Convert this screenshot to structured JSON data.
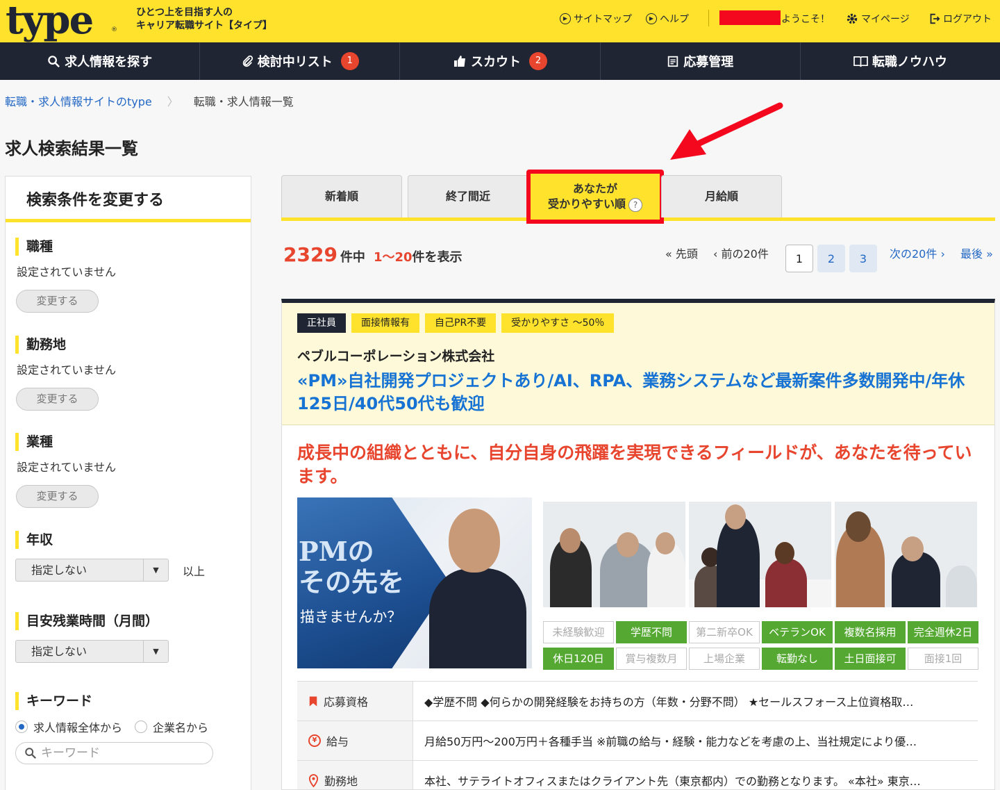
{
  "header": {
    "logo": "type",
    "logo_mark": "®",
    "tagline_1": "ひとつ上を目指す人の",
    "tagline_2": "キャリア転職サイト【タイプ】",
    "sitemap": "サイトマップ",
    "help": "ヘルプ",
    "welcome": "ようこそ！",
    "mypage": "マイページ",
    "logout": "ログアウト"
  },
  "nav": {
    "search": "求人情報を探す",
    "list": "検討中リスト",
    "list_badge": "1",
    "scout": "スカウト",
    "scout_badge": "2",
    "apply": "応募管理",
    "knowhow": "転職ノウハウ"
  },
  "breadcrumb": {
    "home": "転職・求人情報サイトのtype",
    "current": "転職・求人情報一覧"
  },
  "page_title": "求人検索結果一覧",
  "sidebar": {
    "title": "検索条件を変更する",
    "job_label": "職種",
    "job_value": "設定されていません",
    "location_label": "勤務地",
    "location_value": "設定されていません",
    "industry_label": "業種",
    "industry_value": "設定されていません",
    "change_button": "変更する",
    "salary_label": "年収",
    "salary_select": "指定しない",
    "salary_suffix": "以上",
    "overtime_label": "目安残業時間（月間）",
    "overtime_select": "指定しない",
    "keyword_label": "キーワード",
    "radio_all": "求人情報全体から",
    "radio_company": "企業名から",
    "keyword_placeholder": "キーワード"
  },
  "tabs": {
    "newest": "新着順",
    "ending": "終了間近",
    "easy_1": "あなたが",
    "easy_2": "受かりやすい順",
    "easy_help": "?",
    "salary": "月給順"
  },
  "results": {
    "total": "2329",
    "total_suffix": "件中",
    "range": "1〜20",
    "range_suffix": "件を表示"
  },
  "pager": {
    "first": "« 先頭",
    "prev": "‹ 前の20件",
    "p1": "1",
    "p2": "2",
    "p3": "3",
    "next": "次の20件 ›",
    "last": "最後 »"
  },
  "job": {
    "tag_type": "正社員",
    "tag_interview": "面接情報有",
    "tag_pr": "自己PR不要",
    "tag_ease": "受かりやすさ 〜50％",
    "company": "ペブルコーポレーション株式会社",
    "title": "«PM»自社開発プロジェクトあり/AI、RPA、業務システムなど最新案件多数開発中/年休125日/40代50代も歓迎",
    "catch": "成長中の組織とともに、自分自身の飛躍を実現できるフィールドが、あなたを待っています。",
    "image_text_1": "PMの",
    "image_text_2": "その先を",
    "image_text_3": "描きませんか？",
    "features": [
      {
        "label": "未経験歓迎",
        "on": false
      },
      {
        "label": "学歴不問",
        "on": true
      },
      {
        "label": "第二新卒OK",
        "on": false
      },
      {
        "label": "ベテランOK",
        "on": true
      },
      {
        "label": "複数名採用",
        "on": true
      },
      {
        "label": "完全週休2日",
        "on": true
      },
      {
        "label": "休日120日",
        "on": true
      },
      {
        "label": "賞与複数月",
        "on": false
      },
      {
        "label": "上場企業",
        "on": false
      },
      {
        "label": "転勤なし",
        "on": true
      },
      {
        "label": "土日面接可",
        "on": true
      },
      {
        "label": "面接1回",
        "on": false
      }
    ],
    "req_label": "応募資格",
    "req_value": "◆学歴不問 ◆何らかの開発経験をお持ちの方（年数・分野不問） ★セールスフォース上位資格取…",
    "salary_label": "給与",
    "salary_value": "月給50万円〜200万円＋各種手当 ※前職の給与・経験・能力などを考慮の上、当社規定により優…",
    "loc_label": "勤務地",
    "loc_value": "本社、サテライトオフィスまたはクライアント先（東京都内）での勤務となります。 «本社» 東京…"
  },
  "colors": {
    "brand_yellow": "#ffe22b",
    "navy": "#1f2533",
    "link_blue": "#2368c5",
    "accent_red": "#e8452e",
    "annotation_red": "#f4081e",
    "feature_green": "#55a932"
  },
  "icons": {
    "sitemap": "play-circle-icon",
    "help": "play-circle-icon",
    "mypage": "gear-icon",
    "logout": "logout-icon",
    "search": "search-icon",
    "list": "paperclip-icon",
    "scout": "thumbs-up-icon",
    "apply": "clipboard-icon",
    "knowhow": "book-icon",
    "req": "bookmark-icon",
    "salary": "yen-icon",
    "location": "map-pin-icon"
  }
}
